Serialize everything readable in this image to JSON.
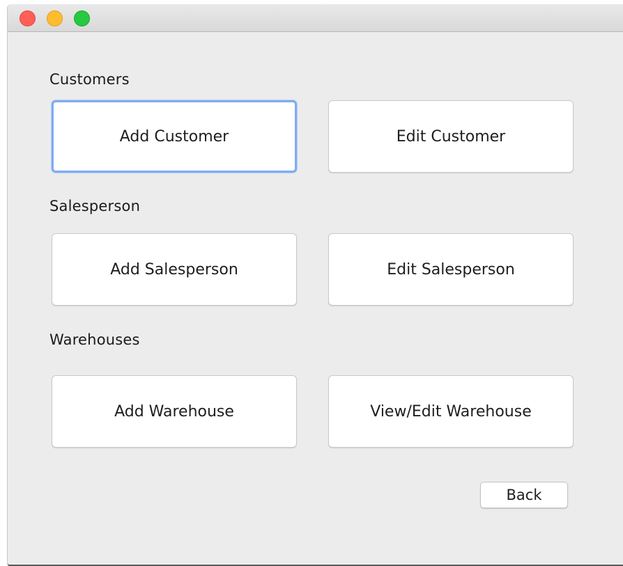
{
  "window": {
    "controls": [
      "close",
      "minimize",
      "zoom"
    ],
    "colors": {
      "close": "#fe5f57",
      "minimize": "#febc2e",
      "zoom": "#28c840",
      "focus_ring": "#80acef"
    }
  },
  "sections": {
    "customers": {
      "label": "Customers",
      "add_label": "Add Customer",
      "edit_label": "Edit Customer"
    },
    "salesperson": {
      "label": "Salesperson",
      "add_label": "Add Salesperson",
      "edit_label": "Edit Salesperson"
    },
    "warehouses": {
      "label": "Warehouses",
      "add_label": "Add Warehouse",
      "edit_label": "View/Edit Warehouse"
    }
  },
  "footer": {
    "back_label": "Back"
  },
  "focused_button": "add-customer-button"
}
